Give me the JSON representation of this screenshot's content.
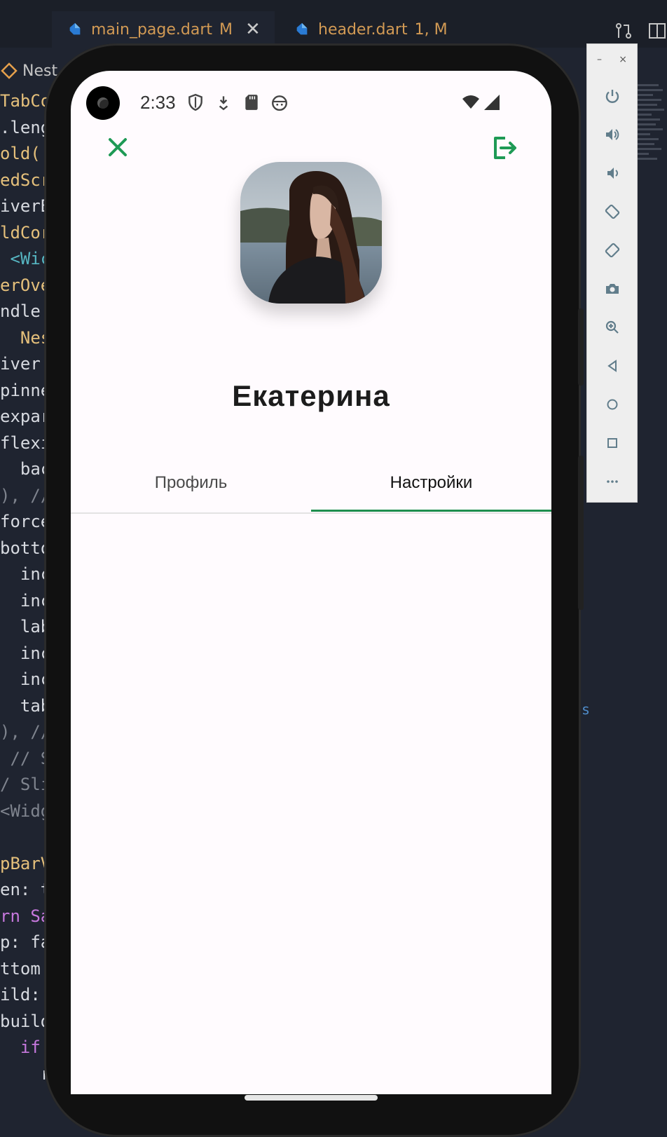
{
  "ide": {
    "tabs": [
      {
        "label": "main_page.dart",
        "status": "M",
        "active": true,
        "close": "✕"
      },
      {
        "label": "header.dart",
        "status": "1, M",
        "active": false
      }
    ],
    "breadcrumb_fragment": "Nest",
    "code_lines": [
      {
        "text": "TabCo",
        "color": "yel"
      },
      {
        "text": ".leng",
        "color": "white"
      },
      {
        "text": "old(",
        "color": "yel"
      },
      {
        "text": "edScr",
        "color": "yel"
      },
      {
        "text": "iverB",
        "color": "white"
      },
      {
        "text": "ldCor",
        "color": "yel"
      },
      {
        "text": " <Wic",
        "color": "tur"
      },
      {
        "text": "erOve",
        "color": "yel"
      },
      {
        "text": "ndle:",
        "color": "white"
      },
      {
        "text": "  Nes",
        "color": "yel"
      },
      {
        "text": "iver:",
        "color": "white"
      },
      {
        "text": "pinne",
        "color": "white"
      },
      {
        "text": "expar",
        "color": "white"
      },
      {
        "text": "flexi",
        "color": "white"
      },
      {
        "text": "  bac",
        "color": "white"
      },
      {
        "text": "), //",
        "color": "grey"
      },
      {
        "text": "force",
        "color": "white"
      },
      {
        "text": "botto",
        "color": "white"
      },
      {
        "text": "  inc",
        "color": "white"
      },
      {
        "text": "  inc",
        "color": "white"
      },
      {
        "text": "  lab",
        "color": "white"
      },
      {
        "text": "  inc",
        "color": "white"
      },
      {
        "text": "  inc",
        "color": "white"
      },
      {
        "text": "  tab",
        "color": "white"
      },
      {
        "text": "), //",
        "color": "grey"
      },
      {
        "text": " // S",
        "color": "grey"
      },
      {
        "text": "/ Sli",
        "color": "grey"
      },
      {
        "text": "<Widg",
        "color": "grey"
      },
      {
        "text": "",
        "color": "white"
      },
      {
        "text": "pBarV",
        "color": "yel"
      },
      {
        "text": "en: t",
        "color": "white"
      },
      {
        "text": "rn Sa",
        "color": "pur"
      },
      {
        "text": "p: fa",
        "color": "white"
      },
      {
        "text": "ttom:",
        "color": "white"
      },
      {
        "text": "ild: ",
        "color": "white"
      },
      {
        "text": "build",
        "color": "white"
      },
      {
        "text": "  if ",
        "color": "pur"
      },
      {
        "text": "    r",
        "color": "white"
      }
    ],
    "right_fragment": "s"
  },
  "emulator_toolbar": {
    "minimize": "–",
    "close": "×",
    "buttons": [
      {
        "name": "power-button",
        "icon": "power-icon"
      },
      {
        "name": "volume-up-button",
        "icon": "volume-up-icon"
      },
      {
        "name": "volume-down-button",
        "icon": "volume-down-icon"
      },
      {
        "name": "rotate-left-button",
        "icon": "rotate-left-icon"
      },
      {
        "name": "rotate-right-button",
        "icon": "rotate-right-icon"
      },
      {
        "name": "screenshot-button",
        "icon": "camera-icon"
      },
      {
        "name": "zoom-button",
        "icon": "zoom-in-icon"
      },
      {
        "name": "back-button",
        "icon": "triangle-back-icon"
      },
      {
        "name": "home-button",
        "icon": "circle-home-icon"
      },
      {
        "name": "overview-button",
        "icon": "square-overview-icon"
      },
      {
        "name": "more-button",
        "icon": "more-dots-icon"
      }
    ]
  },
  "phone": {
    "status_bar": {
      "time": "2:33"
    },
    "profile": {
      "name": "Екатерина"
    },
    "tabs": [
      {
        "label": "Профиль",
        "selected": false
      },
      {
        "label": "Настройки",
        "selected": true
      }
    ],
    "accent_color": "#1e8e4e"
  }
}
